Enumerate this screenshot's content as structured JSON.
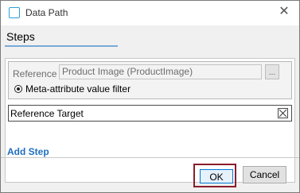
{
  "window": {
    "title": "Data Path",
    "close_glyph": "✕"
  },
  "tab": {
    "label": "Steps"
  },
  "step": {
    "reference_label": "Reference",
    "reference_value": "Product Image (ProductImage)",
    "browse_label": "...",
    "filter_label": "Meta-attribute value filter"
  },
  "target": {
    "label": "Reference Target"
  },
  "add_step_label": "Add Step",
  "buttons": {
    "ok": "OK",
    "cancel": "Cancel"
  },
  "colors": {
    "accent": "#0078d7",
    "link": "#1f6fbf",
    "highlight": "#8b1c2a",
    "tab_underline": "#79a9d8"
  }
}
